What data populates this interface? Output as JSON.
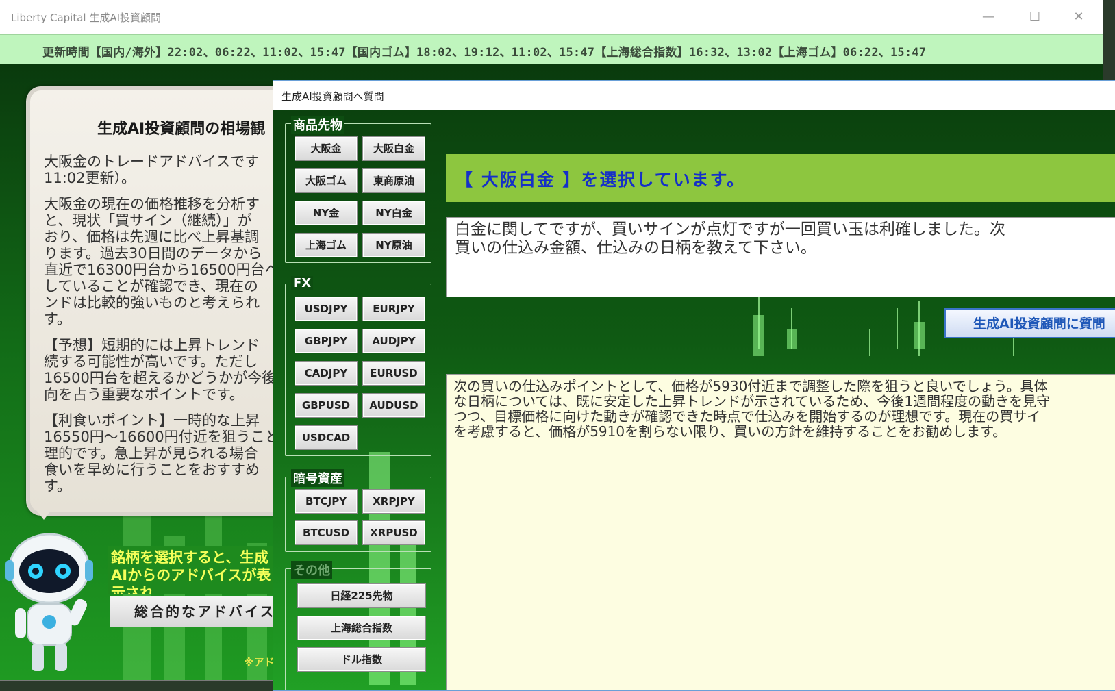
{
  "main_window": {
    "title": "Liberty Capital 生成AI投資顧問",
    "minimize": "—",
    "maximize": "☐",
    "close": "✕"
  },
  "ticker": {
    "text": "更新時間【国内/海外】22:02、06:22、11:02、15:47【国内ゴム】18:02、19:12、11:02、15:47【上海総合指数】16:32、13:02【上海ゴム】06:22、15:47"
  },
  "advice": {
    "title": "生成AI投資顧問の相場観",
    "paragraphs": [
      "大阪金のトレードアドバイスです\n11:02更新）。",
      "大阪金の現在の価格推移を分析す\nと、現状「買サイン（継続）」が\nおり、価格は先週に比べ上昇基調\nります。過去30日間のデータから\n直近で16300円台から16500円台へ\nしていることが確認でき、現在の\nンドは比較的強いものと考えられ\nす。",
      "【予想】短期的には上昇トレンド\n続する可能性が高いです。ただし\n16500円台を超えるかどうかが今後\n向を占う重要なポイントです。",
      "【利食いポイント】一時的な上昇\n16550円～16600円付近を狙うこと\n理的です。急上昇が見られる場合\n食いを早めに行うことをおすすめ\nす。"
    ]
  },
  "hint": {
    "text": "銘柄を選択すると、生成AIからのアドバイスが表示され"
  },
  "overall_button": "総合的なアドバイス",
  "note": "※アド",
  "dialog": {
    "title": "生成AI投資顧問へ質問",
    "groups": {
      "commodities": {
        "label": "商品先物",
        "buttons": [
          "大阪金",
          "大阪白金",
          "大阪ゴム",
          "東商原油",
          "NY金",
          "NY白金",
          "上海ゴム",
          "NY原油"
        ]
      },
      "fx": {
        "label": "FX",
        "buttons": [
          "USDJPY",
          "EURJPY",
          "GBPJPY",
          "AUDJPY",
          "CADJPY",
          "EURUSD",
          "GBPUSD",
          "AUDUSD",
          "USDCAD"
        ]
      },
      "crypto": {
        "label": "暗号資産",
        "buttons": [
          "BTCJPY",
          "XRPJPY",
          "BTCUSD",
          "XRPUSD"
        ]
      },
      "other": {
        "label": "その他",
        "buttons": [
          "日経225先物",
          "上海総合指数",
          "ドル指数"
        ]
      }
    },
    "selection_text": "【 大阪白金 】を選択しています。",
    "question": "白金に関してですが、買いサインが点灯ですが一回買い玉は利確しました。次\n買いの仕込み金額、仕込みの日柄を教えて下さい。",
    "ask_button": "生成AI投資顧問に質問",
    "answer": "次の買いの仕込みポイントとして、価格が5930付近まで調整した際を狙うと良いでしょう。具体\nな日柄については、既に安定した上昇トレンドが示されているため、今後1週間程度の動きを見守\nつつ、目標価格に向けた動きが確認できた時点で仕込みを開始するのが理想です。現在の買サイ\nを考慮すると、価格が5910を割らない限り、買いの方針を維持することをお勧めします。"
  },
  "colors": {
    "ticker_bg": "#bff5bd",
    "selection_banner": "#8dc63f",
    "selection_text": "#1530c8",
    "answer_bg": "#fdfde1",
    "hint_text": "#f5ff5a"
  }
}
